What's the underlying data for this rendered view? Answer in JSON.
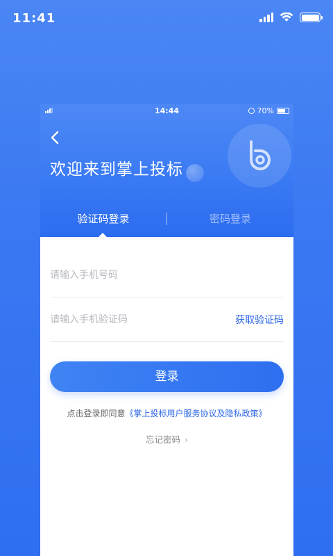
{
  "outer_status": {
    "time": "11:41"
  },
  "inner_status": {
    "time": "14:44",
    "battery": "70%"
  },
  "header": {
    "welcome": "欢迎来到掌上投标"
  },
  "tabs": [
    {
      "label": "验证码登录",
      "active": true
    },
    {
      "label": "密码登录",
      "active": false
    }
  ],
  "form": {
    "phone_placeholder": "请输入手机号码",
    "code_placeholder": "请输入手机验证码",
    "get_code_label": "获取验证码",
    "login_label": "登录"
  },
  "agreement": {
    "prefix": "点击登录即同意",
    "link": "《掌上投标用户服务协议及隐私政策》"
  },
  "forgot": {
    "label": "忘记密码"
  },
  "icons": [
    "back-arrow-icon",
    "logo-icon",
    "signal-icon",
    "wifi-icon",
    "battery-icon",
    "chevron-right-icon"
  ],
  "colors": {
    "primary": "#2e6ff0",
    "link": "#2c67e5"
  }
}
